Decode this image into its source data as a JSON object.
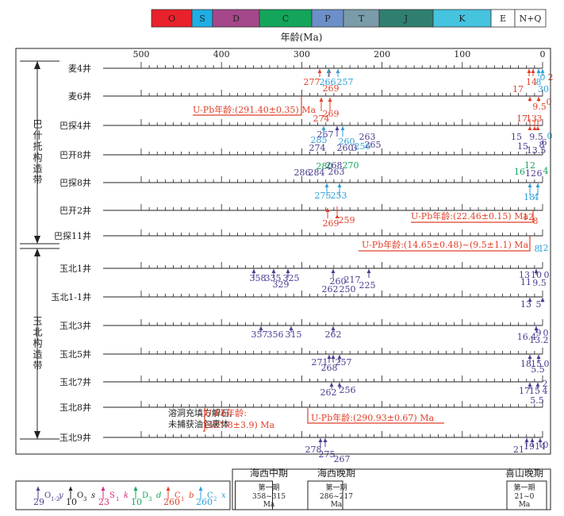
{
  "periods": [
    {
      "label": "O",
      "color": "#e8212b"
    },
    {
      "label": "S",
      "color": "#1faee6"
    },
    {
      "label": "D",
      "color": "#a5478a"
    },
    {
      "label": "C",
      "color": "#13a55a"
    },
    {
      "label": "P",
      "color": "#6b8fc8"
    },
    {
      "label": "T",
      "color": "#7a9ba9"
    },
    {
      "label": "J",
      "color": "#2f7f6f"
    },
    {
      "label": "K",
      "color": "#45c3df"
    },
    {
      "label": "E",
      "color": "#ffffff"
    },
    {
      "label": "N+Q",
      "color": "#ffffff"
    }
  ],
  "axis": {
    "title": "年龄(Ma)",
    "ticks": [
      "500",
      "400",
      "300",
      "200",
      "100",
      "0"
    ]
  },
  "belts": [
    {
      "label": "巴什托构造带"
    },
    {
      "label": "玉北构造带"
    }
  ],
  "wells": [
    {
      "name": "麦4井",
      "labels": [
        {
          "t": "277",
          "c": "#e0402a"
        },
        {
          "t": "269",
          "c": "#e0402a"
        },
        {
          "t": "266",
          "c": "#2f9fd6"
        },
        {
          "t": "257",
          "c": "#2f9fd6"
        },
        {
          "t": "17",
          "c": "#e0402a"
        },
        {
          "t": "14",
          "c": "#e0402a"
        },
        {
          "t": "8",
          "c": "#2f9fd6"
        },
        {
          "t": "0",
          "c": "#2f9fd6"
        },
        {
          "t": "30",
          "c": "#2f9fd6"
        },
        {
          "t": "2",
          "c": "#e0402a"
        }
      ]
    },
    {
      "name": "麦6井",
      "labels": [
        {
          "t": "U-Pb年龄:(291.40±0.35) Ma",
          "c": "#e0402a"
        },
        {
          "t": "269",
          "c": "#e0402a"
        },
        {
          "t": "274",
          "c": "#e0402a"
        },
        {
          "t": "9.5",
          "c": "#e0402a"
        },
        {
          "t": "0",
          "c": "#e0402a"
        }
      ]
    },
    {
      "name": "巴探4井",
      "labels": [
        {
          "t": "285",
          "c": "#2f9fd6"
        },
        {
          "t": "267",
          "c": "#4b3b8f"
        },
        {
          "t": "260",
          "c": "#2f9fd6"
        },
        {
          "t": "263",
          "c": "#4b3b8f"
        },
        {
          "t": "256",
          "c": "#2f9fd6"
        },
        {
          "t": "265",
          "c": "#4b3b8f"
        },
        {
          "t": "17",
          "c": "#e0402a"
        },
        {
          "t": "13",
          "c": "#e0402a"
        },
        {
          "t": "3",
          "c": "#e0402a"
        },
        {
          "t": "15",
          "c": "#4b3b8f"
        },
        {
          "t": "9.5",
          "c": "#4b3b8f"
        },
        {
          "t": "0",
          "c": "#2f9fd6"
        },
        {
          "t": "6",
          "c": "#4b3b8f"
        }
      ]
    },
    {
      "name": "巴开8井",
      "labels": [
        {
          "t": "274",
          "c": "#4b3b8f"
        },
        {
          "t": "260",
          "c": "#4b3b8f"
        },
        {
          "t": "3",
          "c": "#4b3b8f"
        },
        {
          "t": "15",
          "c": "#4b3b8f"
        },
        {
          "t": "8",
          "c": "#4b3b8f"
        },
        {
          "t": "13.5",
          "c": "#4b3b8f"
        }
      ]
    },
    {
      "name": "巴探8井",
      "labels": [
        {
          "t": "286",
          "c": "#4b3b8f"
        },
        {
          "t": "280",
          "c": "#13a55a"
        },
        {
          "t": "284",
          "c": "#4b3b8f"
        },
        {
          "t": "268",
          "c": "#4b3b8f"
        },
        {
          "t": "263",
          "c": "#4b3b8f"
        },
        {
          "t": "270",
          "c": "#13a55a"
        },
        {
          "t": "16",
          "c": "#13a55a"
        },
        {
          "t": "12",
          "c": "#13a55a"
        },
        {
          "t": "12",
          "c": "#4b3b8f"
        },
        {
          "t": "6",
          "c": "#4b3b8f"
        },
        {
          "t": "4",
          "c": "#13a55a"
        },
        {
          "t": "275",
          "c": "#2f9fd6"
        },
        {
          "t": "253",
          "c": "#2f9fd6"
        }
      ]
    },
    {
      "name": "巴开2井",
      "labels": [
        {
          "t": "18",
          "c": "#2f9fd6"
        },
        {
          "t": "4",
          "c": "#2f9fd6"
        },
        {
          "t": "U-Pb年龄:(22.46±0.15) Ma",
          "c": "#e0402a"
        },
        {
          "t": "12",
          "c": "#e0402a"
        },
        {
          "t": "8",
          "c": "#e0402a"
        },
        {
          "t": "269",
          "c": "#e0402a"
        },
        {
          "t": "259",
          "c": "#e0402a"
        }
      ]
    },
    {
      "name": "巴探11井",
      "labels": [
        {
          "t": "U-Pb年龄:(14.65±0.48)~(9.5±1.1) Ma",
          "c": "#e0402a"
        },
        {
          "t": "8",
          "c": "#2f9fd6"
        },
        {
          "t": "1",
          "c": "#2f9fd6"
        },
        {
          "t": "2",
          "c": "#2f9fd6"
        }
      ]
    },
    {
      "name": "玉北1井",
      "labels": [
        {
          "t": "358",
          "c": "#4b3b8f"
        },
        {
          "t": "335",
          "c": "#4b3b8f"
        },
        {
          "t": "325",
          "c": "#4b3b8f"
        },
        {
          "t": "329",
          "c": "#4b3b8f"
        },
        {
          "t": "260",
          "c": "#4b3b8f"
        },
        {
          "t": "217",
          "c": "#4b3b8f"
        },
        {
          "t": "262",
          "c": "#4b3b8f"
        },
        {
          "t": "250",
          "c": "#4b3b8f"
        },
        {
          "t": "225",
          "c": "#4b3b8f"
        },
        {
          "t": "13",
          "c": "#4b3b8f"
        },
        {
          "t": "10",
          "c": "#4b3b8f"
        },
        {
          "t": "0",
          "c": "#4b3b8f"
        },
        {
          "t": "9.5",
          "c": "#4b3b8f"
        }
      ]
    },
    {
      "name": "玉北1-1井",
      "labels": [
        {
          "t": "11",
          "c": "#4b3b8f"
        },
        {
          "t": "13",
          "c": "#4b3b8f"
        },
        {
          "t": "5",
          "c": "#4b3b8f"
        }
      ]
    },
    {
      "name": "玉北3井",
      "labels": [
        {
          "t": "357",
          "c": "#4b3b8f"
        },
        {
          "t": "356",
          "c": "#4b3b8f"
        },
        {
          "t": "315",
          "c": "#4b3b8f"
        },
        {
          "t": "262",
          "c": "#4b3b8f"
        },
        {
          "t": "16.4",
          "c": "#4b3b8f"
        },
        {
          "t": "9",
          "c": "#4b3b8f"
        },
        {
          "t": "0",
          "c": "#4b3b8f"
        },
        {
          "t": "13.",
          "c": "#4b3b8f"
        },
        {
          "t": "2",
          "c": "#4b3b8f"
        }
      ]
    },
    {
      "name": "玉北5井",
      "labels": [
        {
          "t": "271",
          "c": "#4b3b8f"
        },
        {
          "t": "268",
          "c": "#4b3b8f"
        },
        {
          "t": "257",
          "c": "#4b3b8f"
        },
        {
          "t": "18",
          "c": "#4b3b8f"
        },
        {
          "t": "15",
          "c": "#4b3b8f"
        },
        {
          "t": "0",
          "c": "#4b3b8f"
        },
        {
          "t": "5.5",
          "c": "#4b3b8f"
        }
      ]
    },
    {
      "name": "玉北7井",
      "labels": [
        {
          "t": "262",
          "c": "#4b3b8f"
        },
        {
          "t": "256",
          "c": "#4b3b8f"
        },
        {
          "t": "17",
          "c": "#4b3b8f"
        },
        {
          "t": "15",
          "c": "#4b3b8f"
        },
        {
          "t": "2",
          "c": "#4b3b8f"
        },
        {
          "t": "4",
          "c": "#4b3b8f"
        },
        {
          "t": "5.5",
          "c": "#4b3b8f"
        }
      ]
    },
    {
      "name": "玉北8井",
      "labels": [
        {
          "t": "溶洞充填方解石,",
          "c": "#222222"
        },
        {
          "t": "未捕获油包裹体",
          "c": "#222222"
        },
        {
          "t": "U-Pb年龄:",
          "c": "#e0402a"
        },
        {
          "t": "(427.8±3.9) Ma",
          "c": "#e0402a"
        },
        {
          "t": "U-Pb年龄:(290.93±0.67) Ma",
          "c": "#e0402a"
        }
      ]
    },
    {
      "name": "玉北9井",
      "labels": [
        {
          "t": "278",
          "c": "#4b3b8f"
        },
        {
          "t": "275",
          "c": "#4b3b8f"
        },
        {
          "t": "267",
          "c": "#4b3b8f"
        },
        {
          "t": "21",
          "c": "#4b3b8f"
        },
        {
          "t": "19",
          "c": "#4b3b8f"
        },
        {
          "t": "14",
          "c": "#4b3b8f"
        },
        {
          "t": "0",
          "c": "#4b3b8f"
        }
      ]
    }
  ],
  "legend": [
    {
      "value": "29",
      "base": "O",
      "sub": "1-2",
      "suffix": "y",
      "color": "#4b3b8f"
    },
    {
      "value": "10",
      "base": "O",
      "sub": "3",
      "suffix": "s",
      "color": "#222222"
    },
    {
      "value": "23",
      "base": "S",
      "sub": "1",
      "suffix": "k",
      "color": "#d6287d"
    },
    {
      "value": "10",
      "base": "D",
      "sub": "3",
      "suffix": "d",
      "color": "#13a55a"
    },
    {
      "value": "260",
      "base": "C",
      "sub": "1",
      "suffix": "b",
      "color": "#e0402a"
    },
    {
      "value": "260",
      "base": "C",
      "sub": "2",
      "suffix": "x",
      "color": "#2f9fd6"
    }
  ],
  "orogenies": [
    {
      "name": "海西中期",
      "phase": "第一期",
      "range": "358~315",
      "unit": "Ma"
    },
    {
      "name": "海西晚期",
      "phase": "第一期",
      "range": "286~217",
      "unit": "Ma"
    },
    {
      "name": "喜山晚期",
      "phase": "第一期",
      "range": "21~0",
      "unit": "Ma"
    }
  ]
}
